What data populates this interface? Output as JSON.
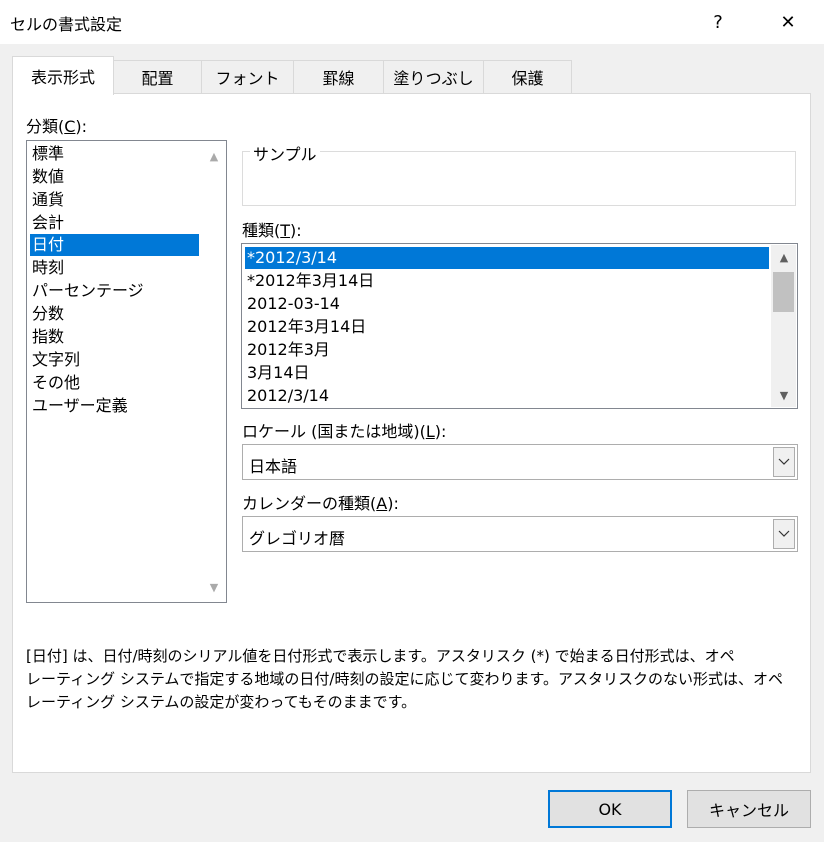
{
  "window": {
    "title": "セルの書式設定",
    "help_label": "?",
    "close_label": "✕"
  },
  "tabs": [
    {
      "label": "表示形式"
    },
    {
      "label": "配置"
    },
    {
      "label": "フォント"
    },
    {
      "label": "罫線"
    },
    {
      "label": "塗りつぶし"
    },
    {
      "label": "保護"
    }
  ],
  "category": {
    "label_pre": "分類(",
    "label_key": "C",
    "label_post": "):",
    "items": [
      "標準",
      "数値",
      "通貨",
      "会計",
      "日付",
      "時刻",
      "パーセンテージ",
      "分数",
      "指数",
      "文字列",
      "その他",
      "ユーザー定義"
    ],
    "selected": "日付"
  },
  "sample": {
    "label": "サンプル",
    "value": ""
  },
  "type": {
    "label_pre": "種類(",
    "label_key": "T",
    "label_post": "):",
    "items": [
      "*2012/3/14",
      "*2012年3月14日",
      "2012-03-14",
      "2012年3月14日",
      "2012年3月",
      "3月14日",
      "2012/3/14"
    ],
    "selected": "*2012/3/14"
  },
  "locale": {
    "label_pre": "ロケール (国または地域)(",
    "label_key": "L",
    "label_post": "):",
    "value": "日本語"
  },
  "calendar": {
    "label_pre": "カレンダーの種類(",
    "label_key": "A",
    "label_post": "):",
    "value": "グレゴリオ暦"
  },
  "description": {
    "line1": "[日付] は、日付/時刻のシリアル値を日付形式で表示します。アスタリスク (*) で始まる日付形式は、オペ",
    "line2": "レーティング システムで指定する地域の日付/時刻の設定に応じて変わります。アスタリスクのない形式は、オペ",
    "line3": "レーティング システムの設定が変わってもそのままです。"
  },
  "buttons": {
    "ok": "OK",
    "cancel": "キャンセル"
  },
  "colors": {
    "selection": "#0078d7",
    "background": "#f0f0f0"
  }
}
